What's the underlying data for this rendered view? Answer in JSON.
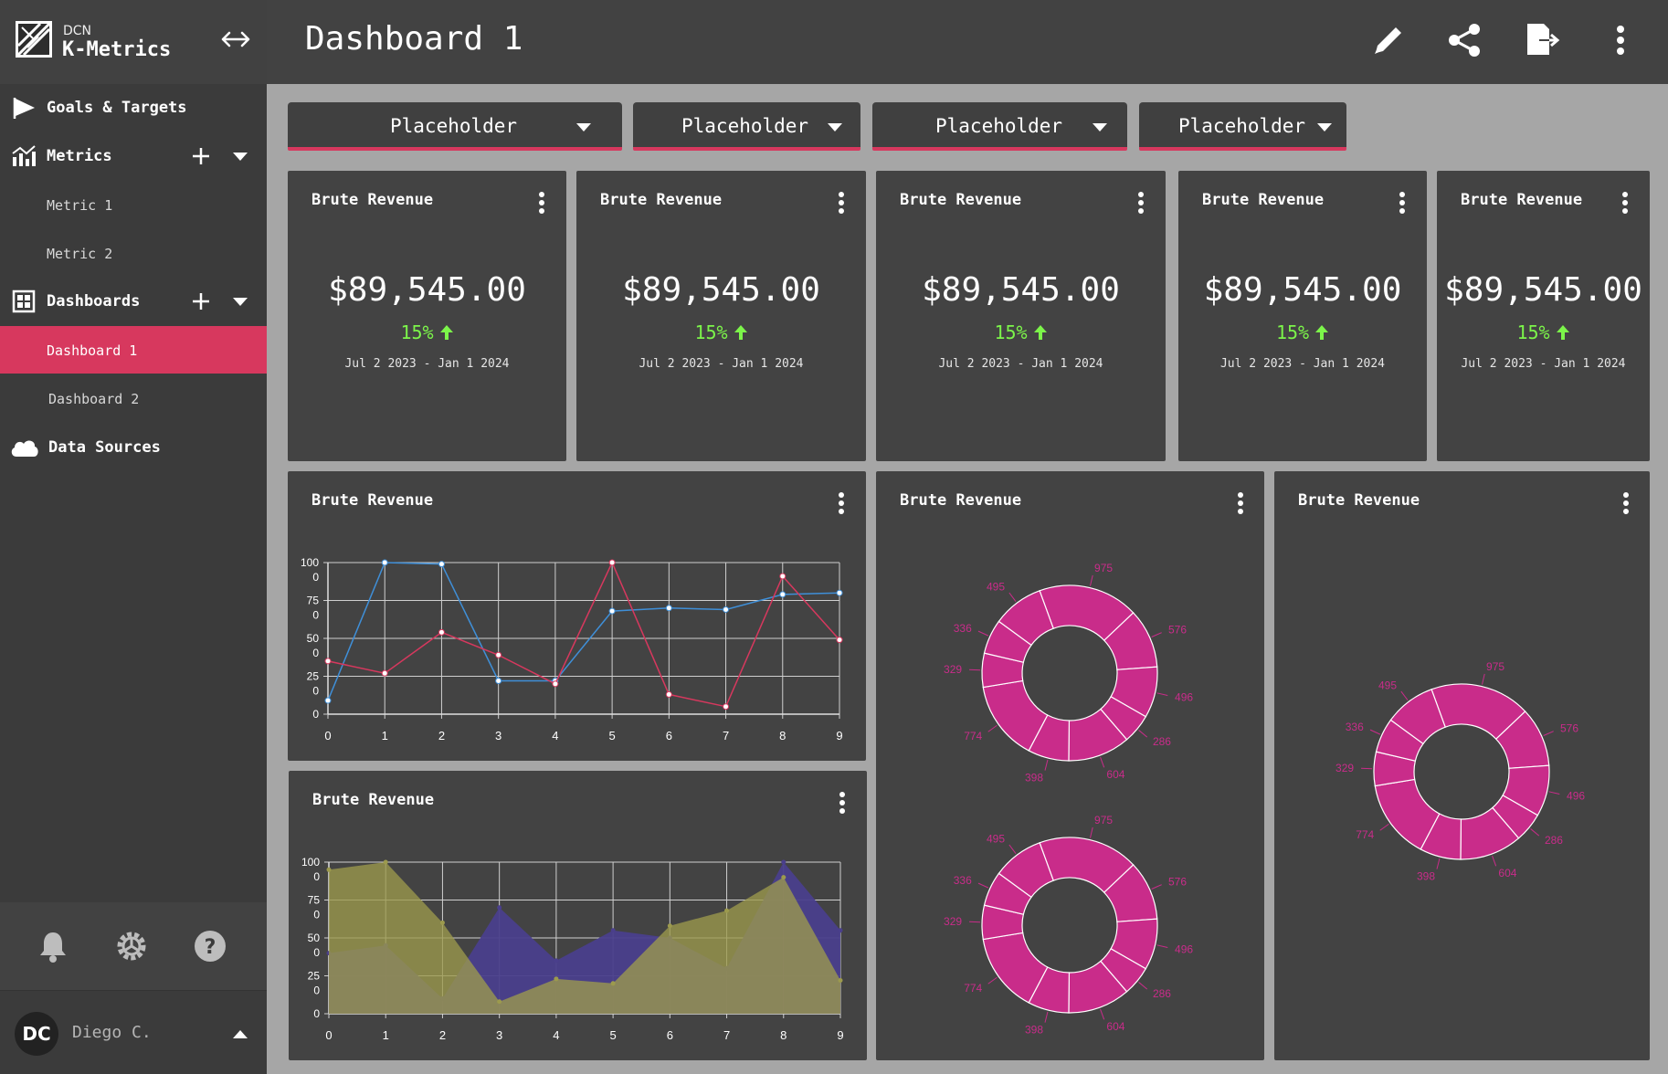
{
  "brand": {
    "company": "DCN",
    "app": "K-Metrics"
  },
  "sidebar": {
    "goals": "Goals & Targets",
    "metrics": "Metrics",
    "metric_items": [
      "Metric 1",
      "Metric 2"
    ],
    "dashboards": "Dashboards",
    "dashboard_items": [
      "Dashboard 1",
      "Dashboard 2"
    ],
    "active_dashboard": "Dashboard 1",
    "data_sources": "Data Sources"
  },
  "user": {
    "initials": "DC",
    "name": "Diego C."
  },
  "header": {
    "title": "Dashboard 1"
  },
  "filters": [
    "Placeholder",
    "Placeholder",
    "Placeholder",
    "Placeholder"
  ],
  "kpis": [
    {
      "title": "Brute Revenue",
      "value": "$89,545.00",
      "change": "15%",
      "range": "Jul 2 2023 - Jan 1 2024"
    },
    {
      "title": "Brute Revenue",
      "value": "$89,545.00",
      "change": "15%",
      "range": "Jul 2 2023 - Jan 1 2024"
    },
    {
      "title": "Brute Revenue",
      "value": "$89,545.00",
      "change": "15%",
      "range": "Jul 2 2023 - Jan 1 2024"
    },
    {
      "title": "Brute Revenue",
      "value": "$89,545.00",
      "change": "15%",
      "range": "Jul 2 2023 - Jan 1 2024"
    },
    {
      "title": "Brute Revenue",
      "value": "$89,545.00",
      "change": "15%",
      "range": "Jul 2 2023 - Jan 1 2024"
    }
  ],
  "chart_cards": [
    "Brute Revenue",
    "Brute Revenue",
    "Brute Revenue",
    "Brute Revenue"
  ],
  "colors": {
    "accent": "#d7385e",
    "positive": "#7cf54a",
    "donut": "#c92c8a"
  },
  "icons": {
    "sidebar": [
      "flag-icon",
      "bar-chart-icon",
      "plus-icon",
      "chevron-down-icon",
      "dashboard-grid-icon",
      "cloud-icon"
    ],
    "footer": [
      "bell-icon",
      "gear-icon",
      "help-icon"
    ],
    "header": [
      "pencil-icon",
      "share-icon",
      "export-icon",
      "more-vertical-icon"
    ]
  },
  "chart_data": [
    {
      "type": "line",
      "x": [
        0,
        1,
        2,
        3,
        4,
        5,
        6,
        7,
        8,
        9
      ],
      "ytick_labels": [
        "100\n0",
        "75\n0",
        "50\n0",
        "25\n0",
        "0"
      ],
      "ylim": [
        0,
        100
      ],
      "grid": true,
      "series": [
        {
          "color": "#3f8fd8",
          "values": [
            9,
            100,
            99,
            22,
            22,
            68,
            70,
            69,
            79,
            80
          ]
        },
        {
          "color": "#d7385e",
          "values": [
            35,
            27,
            54,
            39,
            20,
            100,
            13,
            5,
            91,
            49
          ]
        }
      ]
    },
    {
      "type": "area",
      "x": [
        0,
        1,
        2,
        3,
        4,
        5,
        6,
        7,
        8,
        9
      ],
      "ytick_labels": [
        "100\n0",
        "75\n0",
        "50\n0",
        "25\n0",
        "0"
      ],
      "ylim": [
        0,
        100
      ],
      "grid": true,
      "series": [
        {
          "color": "#4a3f8c",
          "values": [
            40,
            45,
            10,
            70,
            35,
            55,
            50,
            30,
            100,
            55
          ]
        },
        {
          "color": "#9c9a4d",
          "values": [
            95,
            100,
            60,
            8,
            23,
            20,
            58,
            68,
            90,
            22
          ]
        }
      ]
    },
    {
      "type": "pie",
      "values": [
        975,
        576,
        496,
        286,
        604,
        398,
        774,
        329,
        336,
        495
      ]
    },
    {
      "type": "pie",
      "values": [
        975,
        576,
        496,
        286,
        604,
        398,
        774,
        329,
        336,
        495
      ]
    },
    {
      "type": "pie",
      "values": [
        975,
        576,
        496,
        286,
        604,
        398,
        774,
        329,
        336,
        495
      ]
    }
  ]
}
